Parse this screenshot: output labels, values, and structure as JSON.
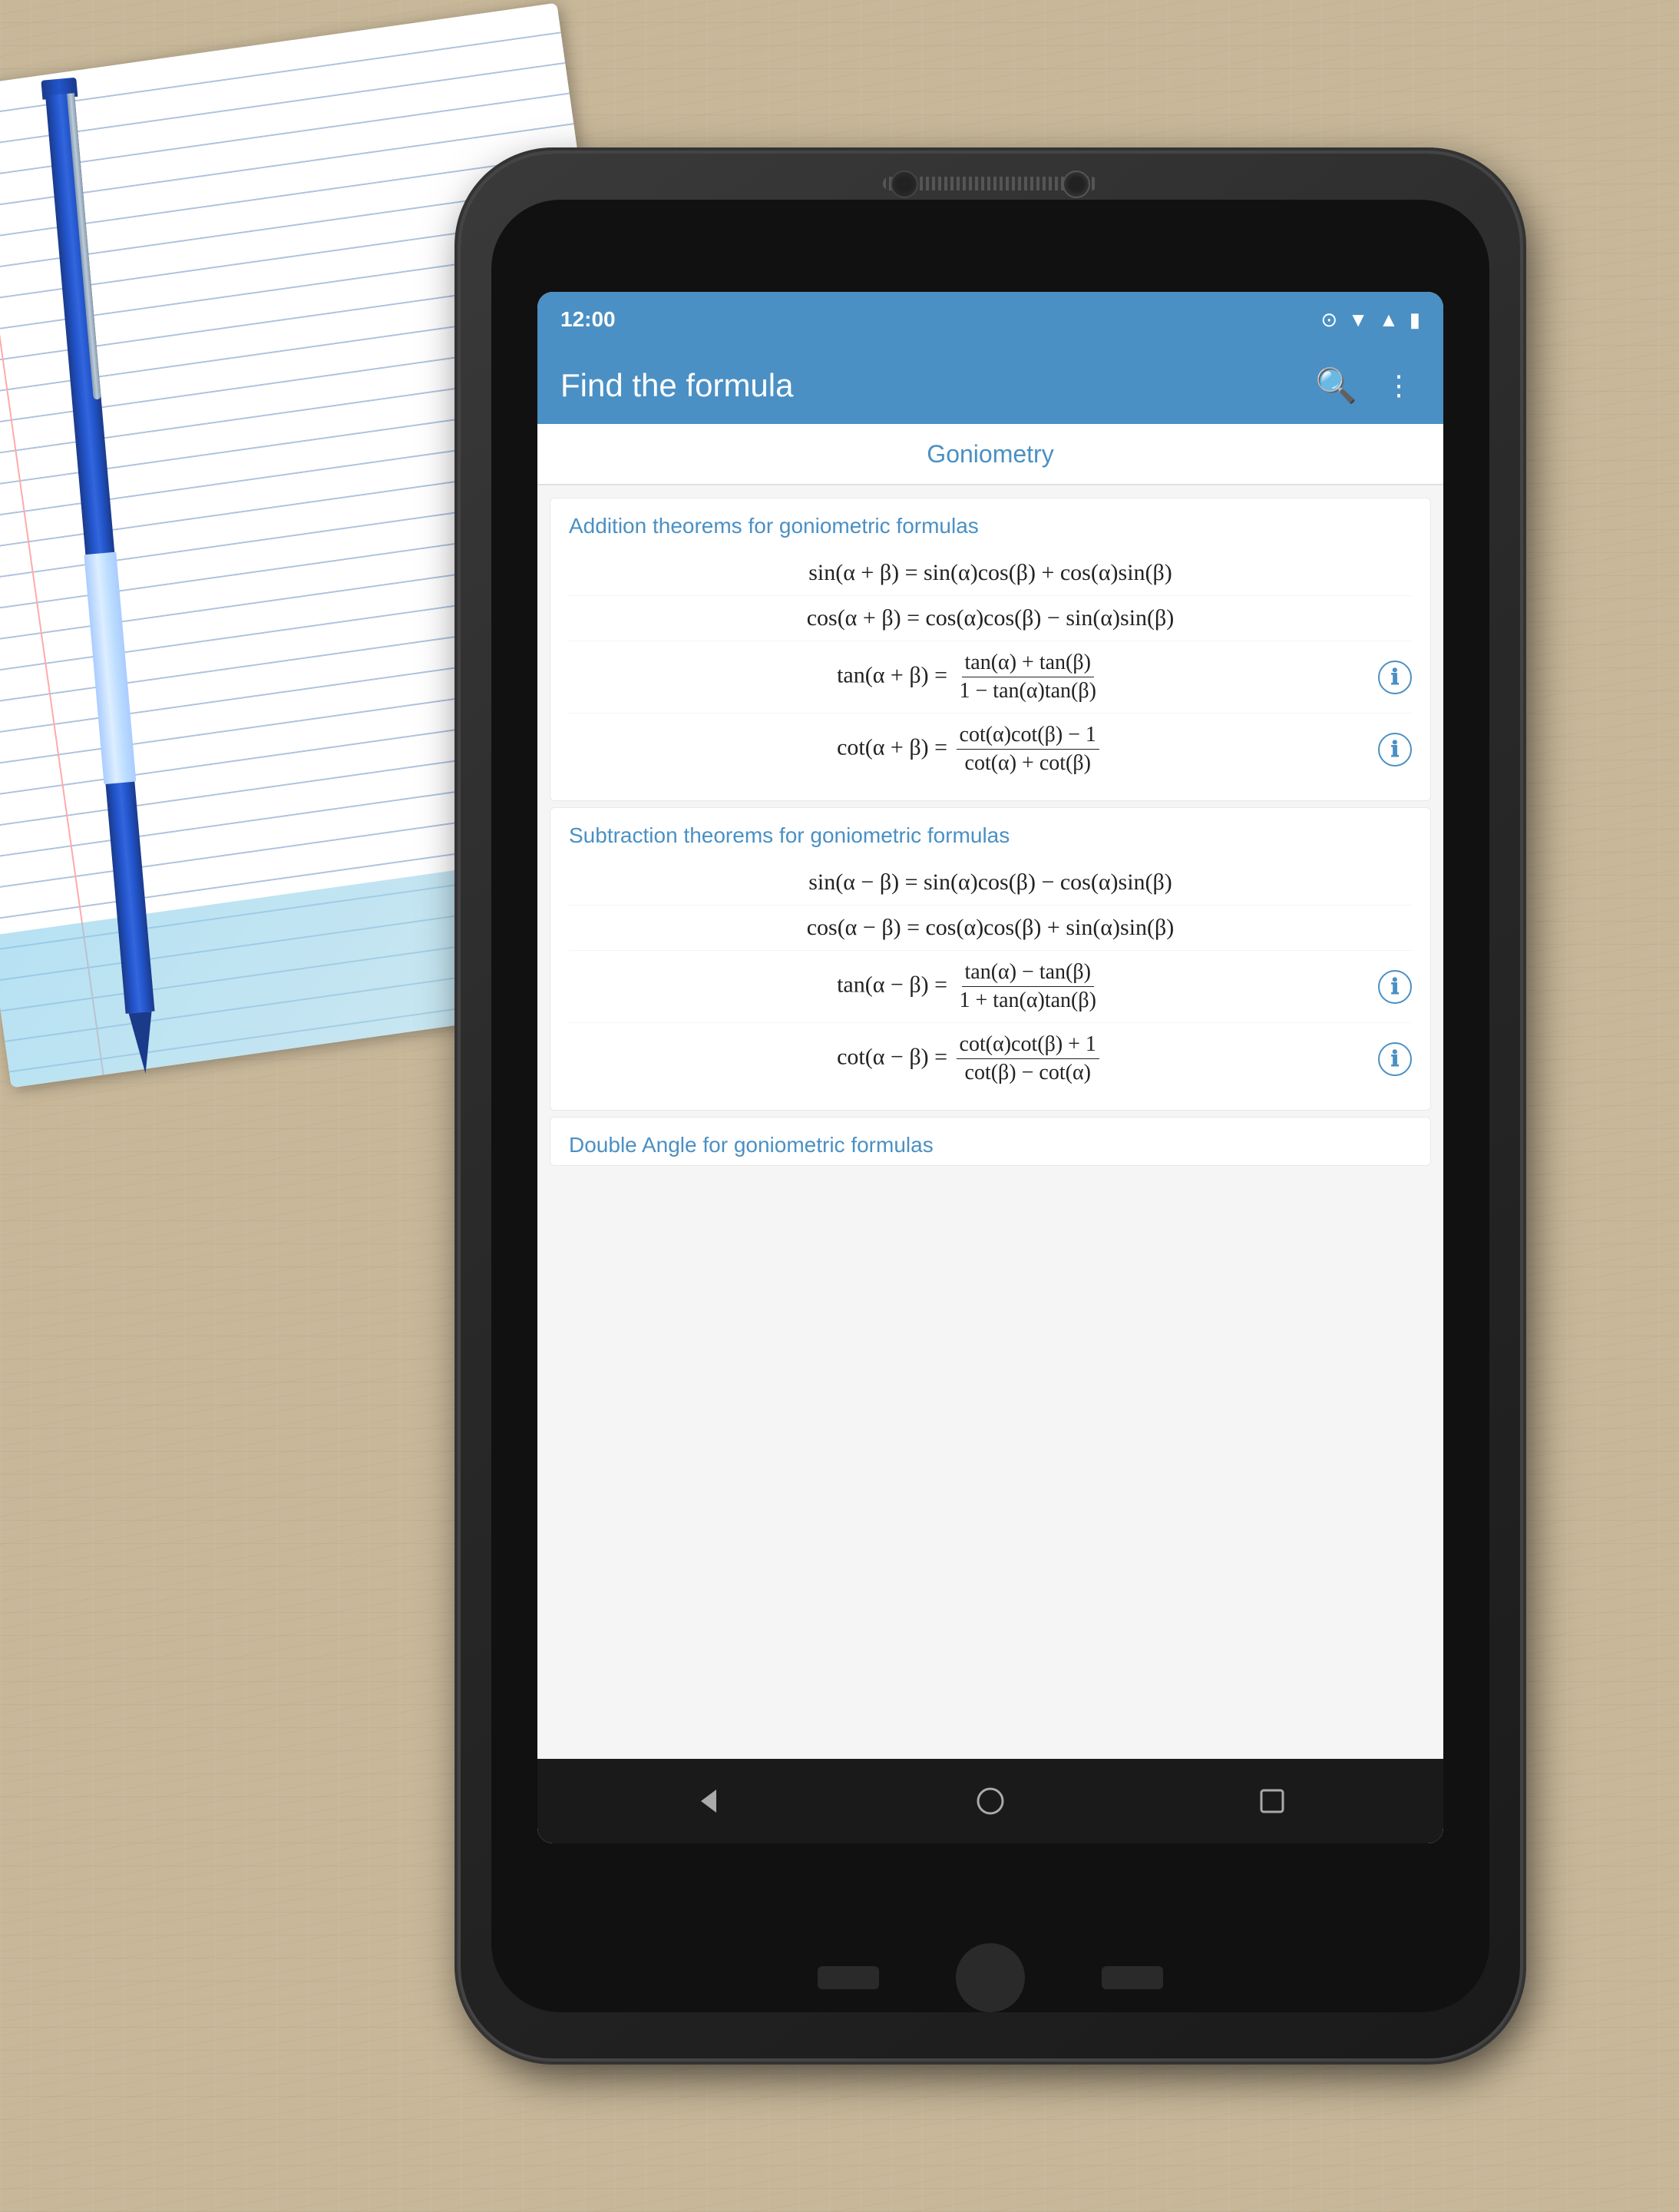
{
  "background": {
    "color": "#c8a87a"
  },
  "status_bar": {
    "time": "12:00",
    "signal_label": "signal",
    "wifi_label": "wifi",
    "battery_label": "battery",
    "circle_label": "notification"
  },
  "app_bar": {
    "title": "Find the formula",
    "search_label": "search",
    "more_label": "more options"
  },
  "tabs": [
    {
      "label": "Goniometry",
      "active": true
    }
  ],
  "sections": [
    {
      "title": "Addition theorems for goniometric formulas",
      "formulas": [
        {
          "text": "sin(α + β) = sin(α)cos(β) + cos(α)sin(β)",
          "has_info": false
        },
        {
          "text": "cos(α + β) = cos(α)cos(β) − sin(α)sin(β)",
          "has_info": false
        },
        {
          "text": "tan(α + β) = [tan(α) + tan(β)] / [1 − tan(α)tan(β)]",
          "has_info": true
        },
        {
          "text": "cot(α + β) = [cot(α)cot(β) − 1] / [cot(α) + cot(β)]",
          "has_info": true
        }
      ]
    },
    {
      "title": "Subtraction theorems for goniometric formulas",
      "formulas": [
        {
          "text": "sin(α − β) = sin(α)cos(β) − cos(α)sin(β)",
          "has_info": false
        },
        {
          "text": "cos(α − β) = cos(α)cos(β) + sin(α)sin(β)",
          "has_info": false
        },
        {
          "text": "tan(α − β) = [tan(α) − tan(β)] / [1 + tan(α)tan(β)]",
          "has_info": true
        },
        {
          "text": "cot(α − β) = [cot(α)cot(β) + 1] / [cot(β) − cot(α)]",
          "has_info": true
        }
      ]
    },
    {
      "title": "Double Angle for goniometric formulas",
      "partial": true
    }
  ],
  "nav_bar": {
    "back_label": "back",
    "home_label": "home",
    "recents_label": "recents"
  }
}
